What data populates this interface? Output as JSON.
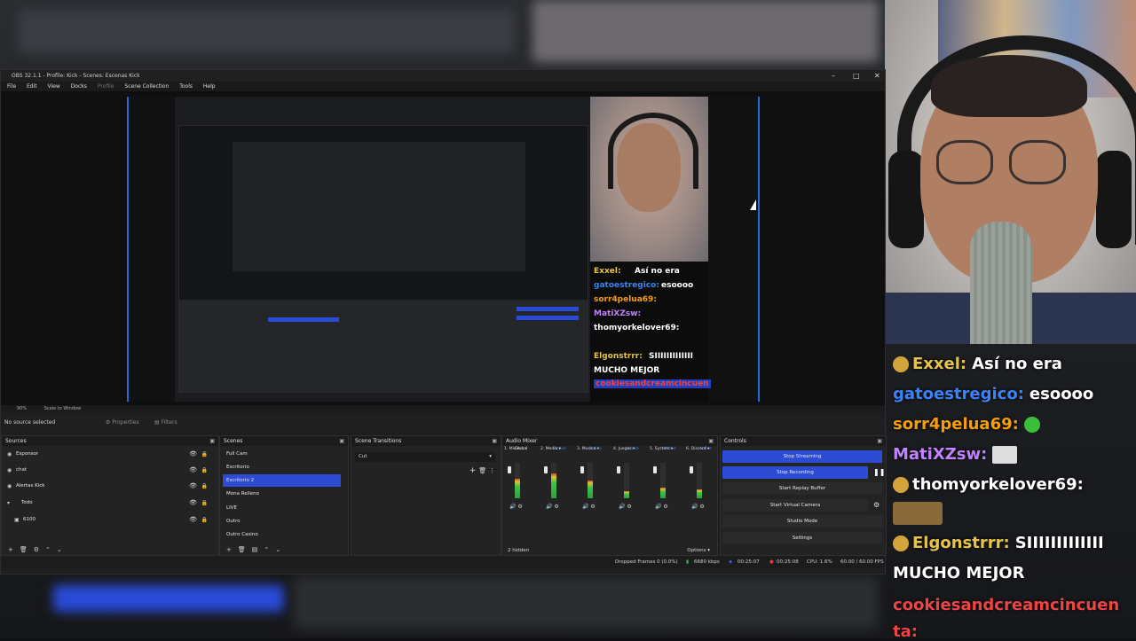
{
  "obs": {
    "title": "OBS 32.1.1 - Profile: Kick - Scenes: Escenas Kick",
    "window_controls": [
      "–",
      "□",
      "✕"
    ],
    "menu": [
      "File",
      "Edit",
      "View",
      "Docks",
      "Profile",
      "Scene Collection",
      "Tools",
      "Help"
    ],
    "preview_scale": "90%",
    "scale_mode": "Scale to Window",
    "no_source_selected": "No source selected",
    "properties_label": "Properties",
    "filters_label": "Filters"
  },
  "sources": {
    "title": "Sources",
    "items": [
      {
        "label": "Esponsor",
        "icon": "scene-icon"
      },
      {
        "label": "chat",
        "icon": "browser-icon"
      },
      {
        "label": "Alertas Kick",
        "icon": "browser-icon"
      },
      {
        "label": "Todo",
        "icon": "folder-icon"
      },
      {
        "label": "6100",
        "icon": "camera-icon"
      }
    ]
  },
  "scenes": {
    "title": "Scenes",
    "items": [
      "Full Cam",
      "Escritorio",
      "Escritorio 2",
      "Mona Relleno",
      "LIVE",
      "Outro",
      "Outro Casino"
    ],
    "selected_index": 2
  },
  "transitions": {
    "title": "Scene Transitions",
    "current": "Cut"
  },
  "mixer": {
    "title": "Audio Mixer",
    "tabs": [
      "Global",
      "Active",
      "Active",
      "Active",
      "Active",
      "Active"
    ],
    "channels": [
      {
        "name": "1. Mic",
        "level": 0.55
      },
      {
        "name": "2. Media",
        "level": 0.7
      },
      {
        "name": "3. Musica",
        "level": 0.5
      },
      {
        "name": "4. Juegos",
        "level": 0.2
      },
      {
        "name": "5. System",
        "level": 0.3
      },
      {
        "name": "6. Discord",
        "level": 0.25
      }
    ],
    "hidden_count": "2 hidden",
    "options_label": "Options"
  },
  "controls": {
    "title": "Controls",
    "buttons": [
      "Stop Streaming",
      "Stop Recording",
      "Start Replay Buffer",
      "Start Virtual Camera",
      "Studio Mode",
      "Settings"
    ]
  },
  "status": {
    "dropped_frames": "Dropped Frames 0 (0.0%)",
    "bitrate": "6680 kbps",
    "stream_time": "00:25:07",
    "rec_time": "00:25:08",
    "cpu": "CPU: 1.6%",
    "fps": "60.00 / 60.00 FPS"
  },
  "nested_chat": [
    {
      "user": "Exxel:",
      "msg": "Así no era",
      "color": "#e6c34a"
    },
    {
      "user": "gatoestregico:",
      "msg": "esoooo",
      "color": "#3b82f6"
    },
    {
      "user": "sorr4pelua69:",
      "msg": "",
      "color": "#f59e0b"
    },
    {
      "user": "MatiXZsw:",
      "msg": "",
      "color": "#c084fc"
    },
    {
      "user": "thomyorkelover69:",
      "msg": "",
      "color": "#ffffff"
    },
    {
      "user": "Elgonstrrr:",
      "msg": "SIIIIIIIIIIIII",
      "color": "#e6c34a"
    },
    {
      "user": "",
      "msg": "MUCHO MEJOR",
      "color": "#ffffff"
    },
    {
      "user": "cookiesandcreamcincuen",
      "msg": "",
      "color": "#ef4444"
    }
  ],
  "chat": [
    {
      "user": "Exxel:",
      "msg": "Así no era",
      "color": "#e6c34a"
    },
    {
      "user": "gatoestregico:",
      "msg": "esoooo",
      "color": "#3b82f6"
    },
    {
      "user": "sorr4pelua69:",
      "msg": "",
      "color": "#f59e0b"
    },
    {
      "user": "MatiXZsw:",
      "msg": "",
      "color": "#c084fc"
    },
    {
      "user": "thomyorkelover69:",
      "msg": "",
      "color": "#ffffff"
    },
    {
      "user": "Elgonstrrr:",
      "msg": "SIIIIIIIIIIIII",
      "color": "#e6c34a"
    },
    {
      "user": "",
      "msg": "MUCHO MEJOR",
      "color": "#ffffff"
    },
    {
      "user": "cookiesandcreamcincuen",
      "msg": "",
      "color": "#ef4444"
    },
    {
      "user": "ta:",
      "msg": "",
      "color": "#ef4444"
    }
  ]
}
